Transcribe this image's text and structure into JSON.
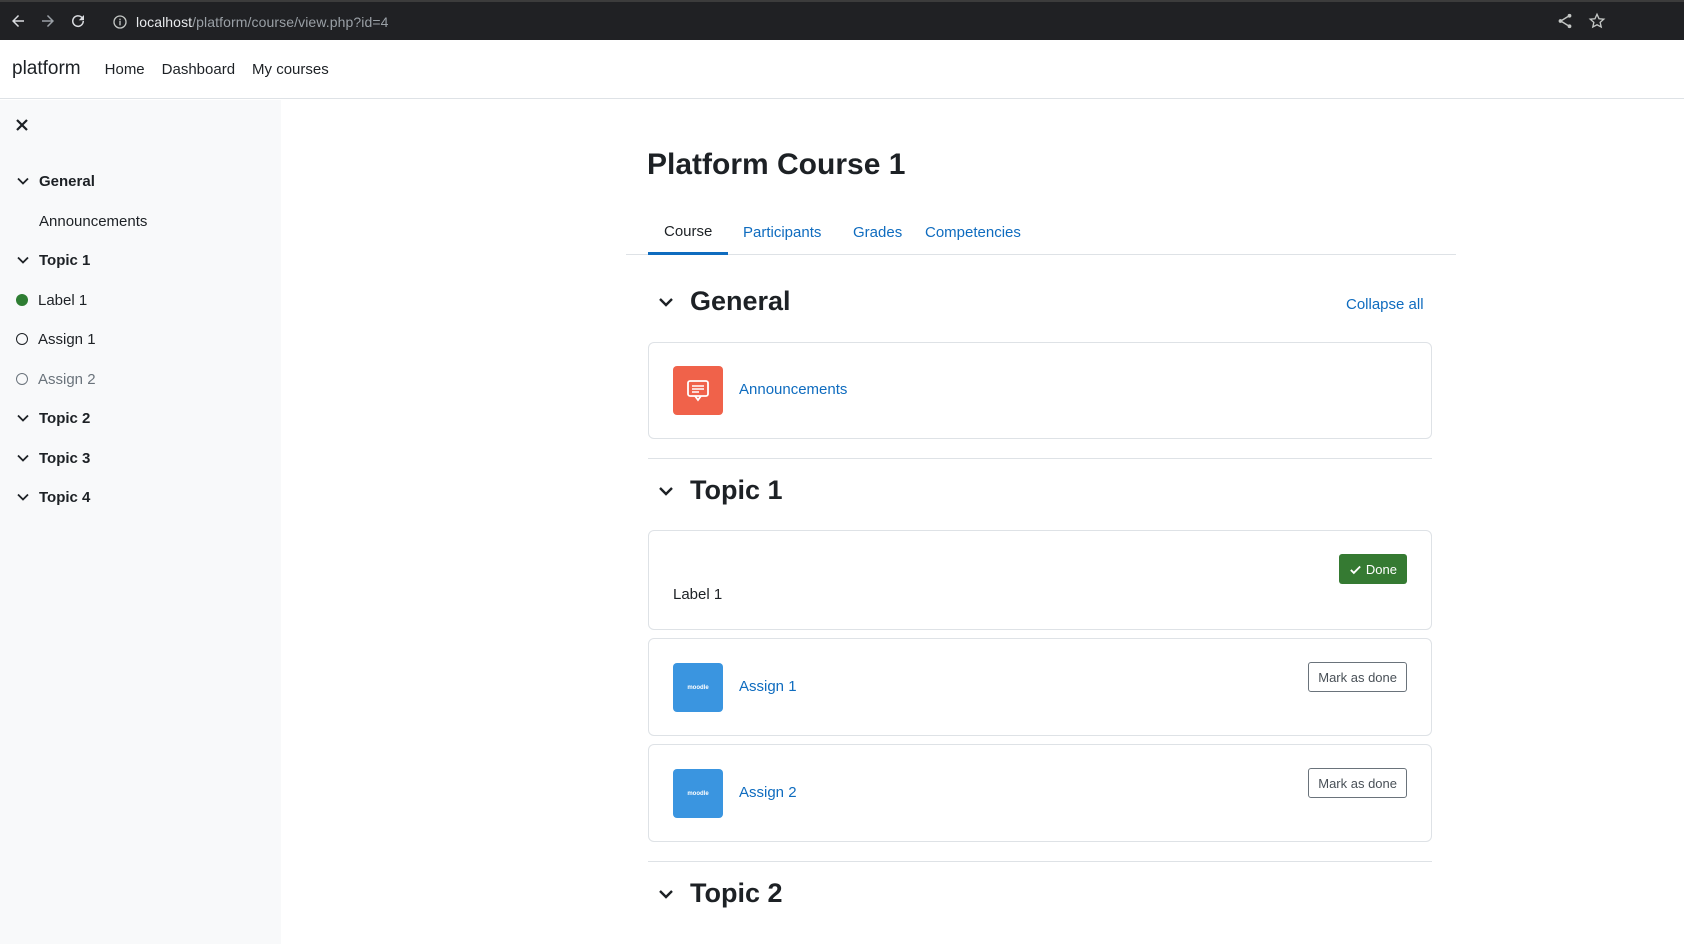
{
  "browser": {
    "url_host": "localhost",
    "url_path": "/platform/course/view.php?id=4"
  },
  "navbar": {
    "brand": "platform",
    "links": [
      "Home",
      "Dashboard",
      "My courses"
    ]
  },
  "drawer": {
    "items": [
      {
        "type": "section",
        "label": "General"
      },
      {
        "type": "activity",
        "label": "Announcements"
      },
      {
        "type": "section",
        "label": "Topic 1"
      },
      {
        "type": "activity",
        "label": "Label 1",
        "status": "complete"
      },
      {
        "type": "activity",
        "label": "Assign 1",
        "status": "incomplete"
      },
      {
        "type": "activity",
        "label": "Assign 2",
        "status": "incomplete"
      },
      {
        "type": "section",
        "label": "Topic 2"
      },
      {
        "type": "section",
        "label": "Topic 3"
      },
      {
        "type": "section",
        "label": "Topic 4"
      }
    ]
  },
  "course": {
    "title": "Platform Course 1",
    "tabs": [
      "Course",
      "Participants",
      "Grades",
      "Competencies"
    ],
    "active_tab": "Course",
    "collapse_all": "Collapse all"
  },
  "sections": [
    {
      "title": "General",
      "activities": [
        {
          "name": "Announcements",
          "icon": "forum-icon"
        }
      ]
    },
    {
      "title": "Topic 1",
      "activities": [
        {
          "name": "Label 1",
          "kind": "label",
          "button": "Done"
        },
        {
          "name": "Assign 1",
          "icon": "assign-icon",
          "button": "Mark as done"
        },
        {
          "name": "Assign 2",
          "icon": "assign-icon",
          "button": "Mark as done"
        }
      ]
    },
    {
      "title": "Topic 2",
      "activities": []
    }
  ],
  "icon_text": "moodle",
  "colors": {
    "accent": "#0f6cbf",
    "done_green": "#357a32",
    "forum_red": "#f0624a",
    "assign_blue": "#3a95e0"
  }
}
